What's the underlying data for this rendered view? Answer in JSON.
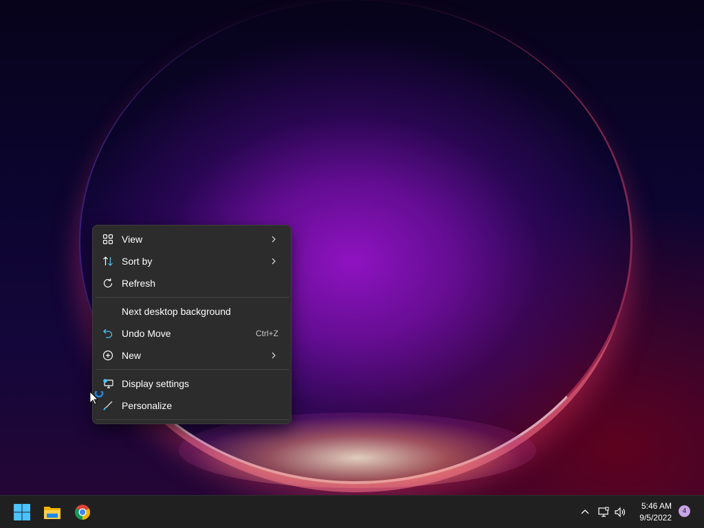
{
  "context_menu": {
    "items": [
      {
        "label": "View",
        "icon": "view-grid-icon",
        "submenu": true
      },
      {
        "label": "Sort by",
        "icon": "sort-icon",
        "submenu": true
      },
      {
        "label": "Refresh",
        "icon": "refresh-icon",
        "submenu": false
      },
      {
        "label": "Next desktop background",
        "icon": "",
        "submenu": false
      },
      {
        "label": "Undo Move",
        "icon": "undo-icon",
        "shortcut": "Ctrl+Z"
      },
      {
        "label": "New",
        "icon": "new-plus-icon",
        "submenu": true
      },
      {
        "label": "Display settings",
        "icon": "display-settings-icon",
        "submenu": false
      },
      {
        "label": "Personalize",
        "icon": "brush-icon",
        "submenu": false
      }
    ]
  },
  "taskbar": {
    "apps": [
      {
        "name": "Start",
        "icon": "windows-start-icon"
      },
      {
        "name": "File Explorer",
        "icon": "file-explorer-icon"
      },
      {
        "name": "Google Chrome",
        "icon": "chrome-icon"
      }
    ],
    "tray": {
      "icons": [
        "show-hidden-icons-chevron-icon",
        "network-icon",
        "volume-icon"
      ],
      "time": "5:46 AM",
      "date": "9/5/2022",
      "notifications": "4"
    }
  },
  "colors": {
    "menu_bg": "#2c2c2c",
    "taskbar_bg": "#202020",
    "accent": "#4cc2ff"
  }
}
